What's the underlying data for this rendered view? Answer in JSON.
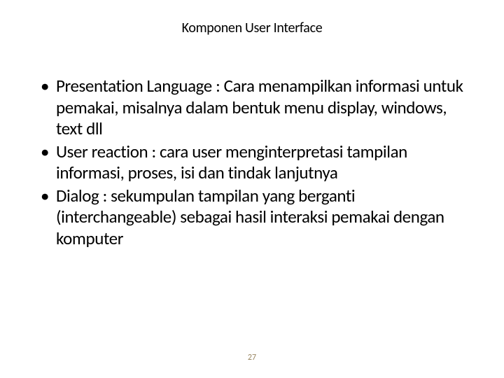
{
  "title": "Komponen User Interface",
  "bullets": [
    "Presentation Language : Cara menampilkan informasi untuk pemakai, misalnya dalam bentuk menu display, windows, text dll",
    "User reaction : cara user menginterpretasi tampilan informasi, proses, isi dan tindak lanjutnya",
    "Dialog : sekumpulan tampilan yang berganti (interchangeable) sebagai hasil interaksi pemakai dengan komputer"
  ],
  "page_number": "27"
}
